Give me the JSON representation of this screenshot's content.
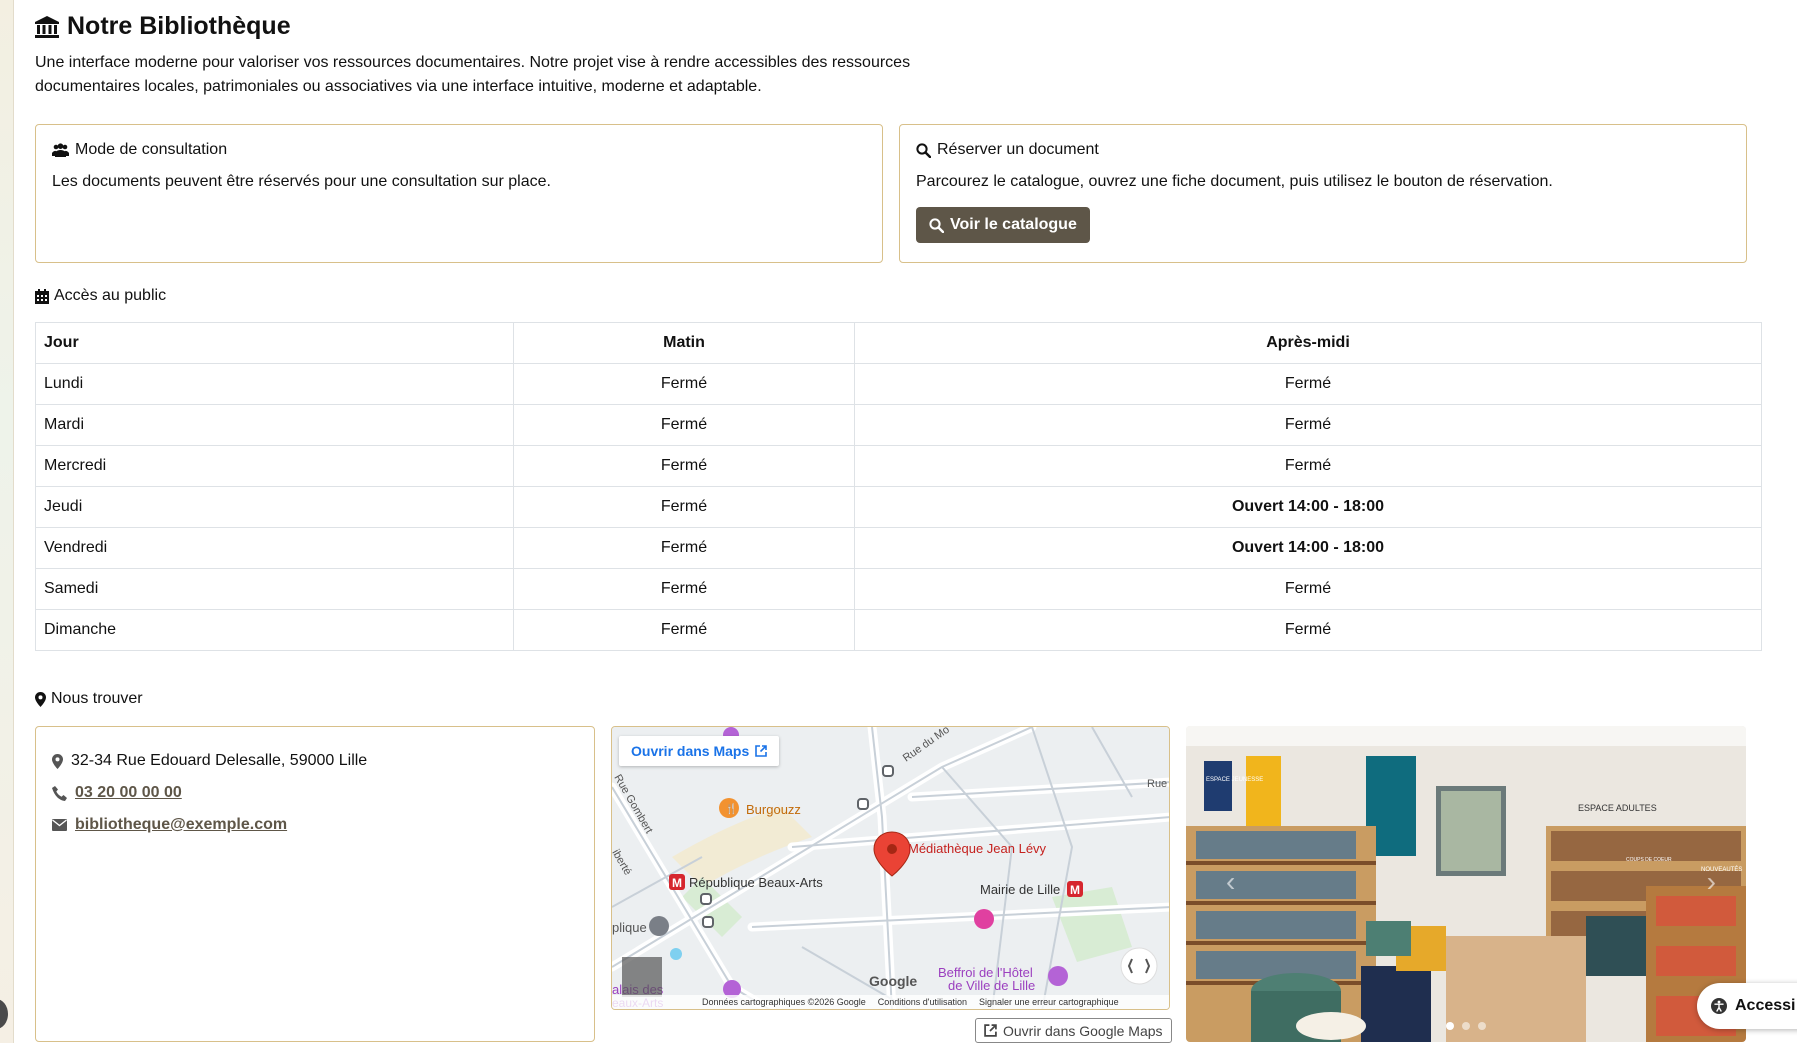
{
  "header": {
    "title": "Notre Bibliothèque",
    "intro": "Une interface moderne pour valoriser vos ressources documentaires. Notre projet vise à rendre accessibles des ressources documentaires locales, patrimoniales ou associatives via une interface intuitive, moderne et adaptable."
  },
  "cards": {
    "consultation": {
      "title": "Mode de consultation",
      "text": "Les documents peuvent être réservés pour une consultation sur place."
    },
    "reserve": {
      "title": "Réserver un document",
      "text": "Parcourez le catalogue, ouvrez une fiche document, puis utilisez le bouton de réservation.",
      "button": "Voir le catalogue"
    }
  },
  "hours": {
    "title": "Accès au public",
    "headers": [
      "Jour",
      "Matin",
      "Après-midi"
    ],
    "rows": [
      [
        "Lundi",
        "Fermé",
        "Fermé"
      ],
      [
        "Mardi",
        "Fermé",
        "Fermé"
      ],
      [
        "Mercredi",
        "Fermé",
        "Fermé"
      ],
      [
        "Jeudi",
        "Fermé",
        "Ouvert 14:00 - 18:00"
      ],
      [
        "Vendredi",
        "Fermé",
        "Ouvert 14:00 - 18:00"
      ],
      [
        "Samedi",
        "Fermé",
        "Fermé"
      ],
      [
        "Dimanche",
        "Fermé",
        "Fermé"
      ]
    ]
  },
  "location": {
    "title": "Nous trouver",
    "address": "32-34 Rue Edouard Delesalle, 59000 Lille",
    "phone": "03 20 00 00 00",
    "email": "bibliotheque@exemple.com"
  },
  "map": {
    "open_in_maps": "Ouvrir dans Maps",
    "marker_label": "Médiathèque Jean Lévy",
    "places": [
      "Burgouzz",
      "République Beaux-Arts",
      "Mairie de Lille",
      "Beffroi de l'Hôtel de Ville de Lille",
      "alais des eaux-Arts",
      "Rue Gombert",
      "Rue du Mo",
      "Rue",
      "iberté",
      "plique"
    ],
    "footer": [
      "Données cartographiques ©2026 Google",
      "Conditions d'utilisation",
      "Signaler une erreur cartographique"
    ],
    "google_logo": "Google",
    "open_google_maps": "Ouvrir dans Google Maps"
  },
  "photo": {
    "signs": [
      "ESPACE JEUNESSE",
      "ESPACE ADULTES",
      "NOUVEAUTÉS",
      "COUPS DE COEUR"
    ]
  },
  "accessibility": {
    "label": "Accessi"
  }
}
